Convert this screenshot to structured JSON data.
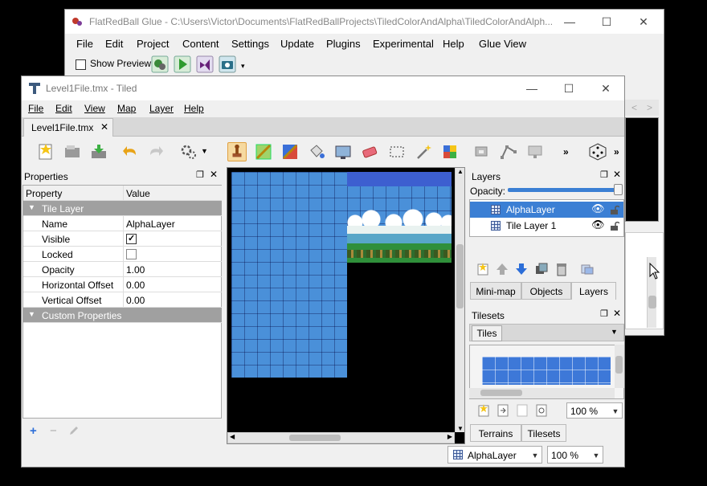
{
  "glue": {
    "title": "FlatRedBall Glue - C:\\Users\\Victor\\Documents\\FlatRedBallProjects\\TiledColorAndAlpha\\TiledColorAndAlph...",
    "menu": [
      "File",
      "Edit",
      "Project",
      "Content",
      "Settings",
      "Update",
      "Plugins",
      "Experimental",
      "Help",
      "Glue View"
    ],
    "show_preview_label": "Show Preview",
    "show_preview_checked": false
  },
  "tiled": {
    "title": "Level1File.tmx - Tiled",
    "menu": [
      "File",
      "Edit",
      "View",
      "Map",
      "Layer",
      "Help"
    ],
    "doc_tab": "Level1File.tmx",
    "properties": {
      "title": "Properties",
      "col_property": "Property",
      "col_value": "Value",
      "group_tile_layer": "Tile Layer",
      "rows": [
        {
          "key": "Name",
          "value": "AlphaLayer"
        },
        {
          "key": "Visible",
          "value": ""
        },
        {
          "key": "Locked",
          "value": ""
        },
        {
          "key": "Opacity",
          "value": "1.00"
        },
        {
          "key": "Horizontal Offset",
          "value": "0.00"
        },
        {
          "key": "Vertical Offset",
          "value": "0.00"
        }
      ],
      "visible_checked": true,
      "locked_checked": false,
      "group_custom": "Custom Properties"
    },
    "layers": {
      "title": "Layers",
      "opacity_label": "Opacity:",
      "opacity_value": 1.0,
      "items": [
        {
          "name": "AlphaLayer",
          "selected": true
        },
        {
          "name": "Tile Layer 1",
          "selected": false
        }
      ],
      "tabs": [
        "Mini-map",
        "Objects",
        "Layers"
      ]
    },
    "tilesets": {
      "title": "Tilesets",
      "tab": "Tiles",
      "zoom": "100 %",
      "bottom_tabs": [
        "Terrains",
        "Tilesets"
      ]
    },
    "status": {
      "layer": "AlphaLayer",
      "zoom": "100 %"
    }
  },
  "colors": {
    "selection": "#3b7fd4",
    "sky": "#4a90d9",
    "group_header": "#a0a0a0"
  }
}
